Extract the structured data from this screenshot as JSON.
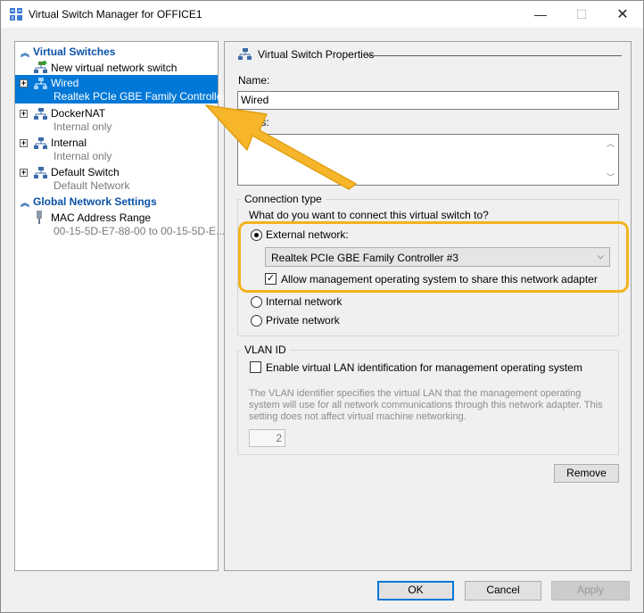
{
  "window": {
    "title": "Virtual Switch Manager for OFFICE1",
    "controls": {
      "minimize": "—",
      "maximize": "☐",
      "close": "✕"
    }
  },
  "sidebar": {
    "virtual_switches_header": "Virtual Switches",
    "new_switch_label": "New virtual network switch",
    "switches": [
      {
        "name": "Wired",
        "detail": "Realtek PCIe GBE Family Controller...",
        "selected": true
      },
      {
        "name": "DockerNAT",
        "detail": "Internal only"
      },
      {
        "name": "Internal",
        "detail": "Internal only"
      },
      {
        "name": "Default Switch",
        "detail": "Default Network"
      }
    ],
    "global_header": "Global Network Settings",
    "mac_label": "MAC Address Range",
    "mac_value": "00-15-5D-E7-88-00 to 00-15-5D-E..."
  },
  "properties": {
    "header": "Virtual Switch Properties",
    "name_label": "Name:",
    "name_value": "Wired",
    "notes_label": "Notes:",
    "notes_value": "",
    "connection_type": {
      "title": "Connection type",
      "question": "What do you want to connect this virtual switch to?",
      "external_label": "External network:",
      "adapter_selected": "Realtek PCIe GBE Family Controller #3",
      "allow_mgmt_label": "Allow management operating system to share this network adapter",
      "allow_mgmt_checked": true,
      "internal_label": "Internal network",
      "private_label": "Private network",
      "selected": "external"
    },
    "vlan": {
      "title": "VLAN ID",
      "enable_label": "Enable virtual LAN identification for management operating system",
      "enable_checked": false,
      "description": "The VLAN identifier specifies the virtual LAN that the management operating system will use for all network communications through this network adapter. This setting does not affect virtual machine networking.",
      "vlan_id_value": "2"
    },
    "remove_label": "Remove"
  },
  "footer": {
    "ok_label": "OK",
    "cancel_label": "Cancel",
    "apply_label": "Apply"
  },
  "colors": {
    "selection": "#0078d7",
    "section_header": "#0a52a8",
    "highlight": "#f2b41e"
  }
}
